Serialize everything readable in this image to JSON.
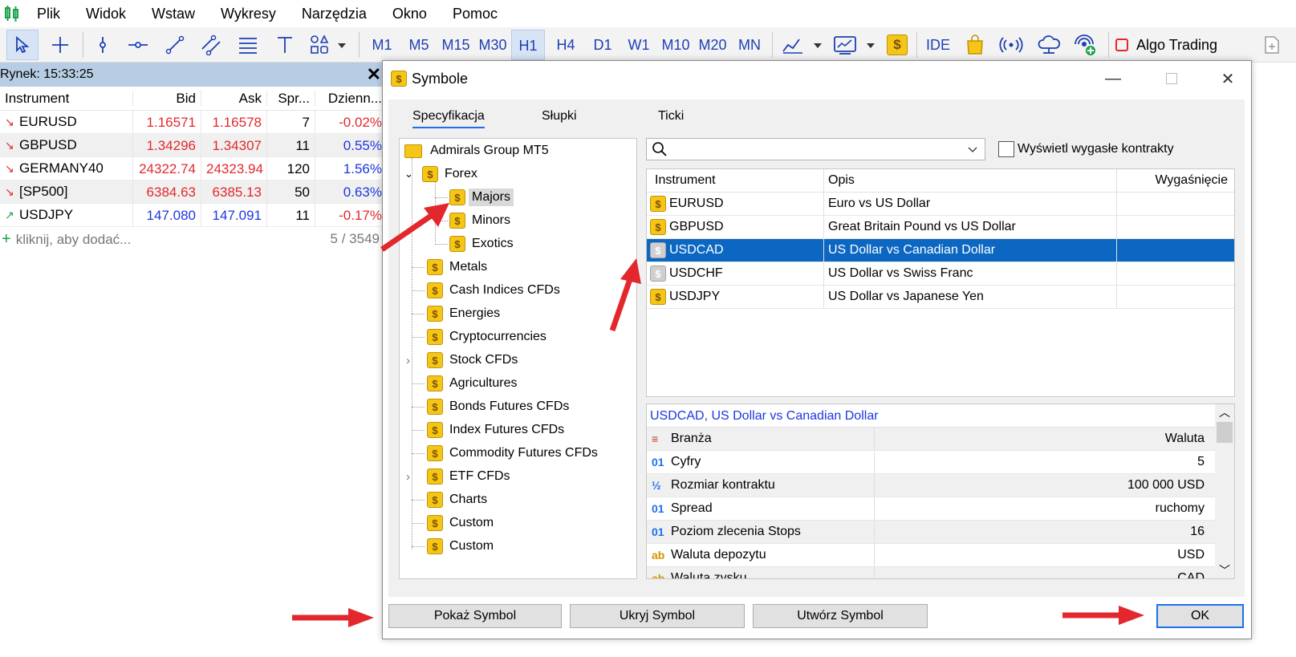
{
  "menu": [
    "Plik",
    "Widok",
    "Wstaw",
    "Wykresy",
    "Narzędzia",
    "Okno",
    "Pomoc"
  ],
  "timeframes": [
    "M1",
    "M5",
    "M15",
    "M30",
    "H1",
    "H4",
    "D1",
    "W1",
    "M10",
    "M20",
    "MN"
  ],
  "active_timeframe": "H1",
  "toolbar": {
    "ide_label": "IDE",
    "algo_label": "Algo Trading"
  },
  "market_watch": {
    "title": "Rynek: 15:33:25",
    "columns": [
      "Instrument",
      "Bid",
      "Ask",
      "Spr...",
      "Dzienn..."
    ],
    "rows": [
      {
        "symbol": "EURUSD",
        "bid": "1.16571",
        "ask": "1.16578",
        "spread": "7",
        "daily": "-0.02%",
        "dir": "down"
      },
      {
        "symbol": "GBPUSD",
        "bid": "1.34296",
        "ask": "1.34307",
        "spread": "11",
        "daily": "0.55%",
        "dir": "down"
      },
      {
        "symbol": "GERMANY40",
        "bid": "24322.74",
        "ask": "24323.94",
        "spread": "120",
        "daily": "1.56%",
        "dir": "down"
      },
      {
        "symbol": "[SP500]",
        "bid": "6384.63",
        "ask": "6385.13",
        "spread": "50",
        "daily": "0.63%",
        "dir": "down"
      },
      {
        "symbol": "USDJPY",
        "bid": "147.080",
        "ask": "147.091",
        "spread": "11",
        "daily": "-0.17%",
        "dir": "up"
      }
    ],
    "add_label": "kliknij, aby dodać...",
    "count": "5 / 3549"
  },
  "dialog": {
    "title": "Symbole",
    "tabs": [
      "Specyfikacja",
      "Słupki",
      "Ticki"
    ],
    "tree": {
      "root": "Admirals Group MT5",
      "forex": "Forex",
      "forex_children": [
        "Majors",
        "Minors",
        "Exotics"
      ],
      "groups": [
        "Metals",
        "Cash Indices CFDs",
        "Energies",
        "Cryptocurrencies",
        "Stock CFDs",
        "Agricultures",
        "Bonds Futures CFDs",
        "Index Futures CFDs",
        "Commodity Futures CFDs",
        "ETF CFDs",
        "Charts",
        "Custom",
        "Custom"
      ]
    },
    "expired_label": "Wyświetl wygasłe kontrakty",
    "symbol_columns": [
      "Instrument",
      "Opis",
      "Wygaśnięcie"
    ],
    "symbols": [
      {
        "symbol": "EURUSD",
        "desc": "Euro vs US Dollar",
        "expiry": "",
        "active": true
      },
      {
        "symbol": "GBPUSD",
        "desc": "Great Britain Pound vs US Dollar",
        "expiry": "",
        "active": true
      },
      {
        "symbol": "USDCAD",
        "desc": "US Dollar vs Canadian Dollar",
        "expiry": "",
        "active": false
      },
      {
        "symbol": "USDCHF",
        "desc": "US Dollar vs Swiss Franc",
        "expiry": "",
        "active": false
      },
      {
        "symbol": "USDJPY",
        "desc": "US Dollar vs Japanese Yen",
        "expiry": "",
        "active": true
      }
    ],
    "spec_title": "USDCAD, US Dollar vs Canadian Dollar",
    "spec_rows": [
      {
        "icon": "≡",
        "key": "Branża",
        "value": "Waluta"
      },
      {
        "icon": "01",
        "key": "Cyfry",
        "value": "5"
      },
      {
        "icon": "½",
        "key": "Rozmiar kontraktu",
        "value": "100 000 USD"
      },
      {
        "icon": "01",
        "key": "Spread",
        "value": "ruchomy"
      },
      {
        "icon": "01",
        "key": "Poziom zlecenia Stops",
        "value": "16"
      },
      {
        "icon": "ab",
        "key": "Waluta depozytu",
        "value": "USD"
      },
      {
        "icon": "ab",
        "key": "Waluta zysku",
        "value": "CAD"
      }
    ],
    "buttons": {
      "show": "Pokaż Symbol",
      "hide": "Ukryj Symbol",
      "create": "Utwórz Symbol",
      "ok": "OK"
    }
  },
  "colors": {
    "accent": "#1d6ff2",
    "selection": "#0b67c2",
    "arrow": "#e3282d"
  }
}
